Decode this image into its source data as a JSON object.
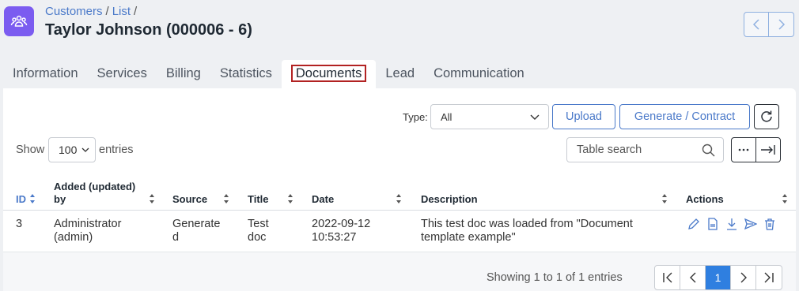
{
  "breadcrumb": {
    "part1": "Customers",
    "sep1": "/",
    "part2": "List",
    "sep2": "/"
  },
  "title": "Taylor Johnson (000006 - 6)",
  "tabs": [
    {
      "label": "Information"
    },
    {
      "label": "Services"
    },
    {
      "label": "Billing"
    },
    {
      "label": "Statistics"
    },
    {
      "label": "Documents"
    },
    {
      "label": "Lead"
    },
    {
      "label": "Communication"
    }
  ],
  "toolbar": {
    "type_label": "Type:",
    "type_value": "All",
    "upload_label": "Upload",
    "generate_label": "Generate / Contract"
  },
  "table_controls": {
    "show_label": "Show",
    "entries_value": "100",
    "entries_label": "entries",
    "search_placeholder": "Table search"
  },
  "columns": {
    "id": "ID",
    "added_line1": "Added (updated)",
    "added_line2": "by",
    "source": "Source",
    "title": "Title",
    "date": "Date",
    "description": "Description",
    "actions": "Actions"
  },
  "rows": [
    {
      "id": "3",
      "added_line1": "Administrator",
      "added_line2": "(admin)",
      "source_line1": "Generate",
      "source_line2": "d",
      "title_line1": "Test",
      "title_line2": "doc",
      "date_line1": "2022-09-12",
      "date_line2": "10:53:27",
      "desc_line1": "This test doc was loaded from \"Document",
      "desc_line2": "template example\""
    }
  ],
  "footer": {
    "showing": "Showing 1 to 1 of 1 entries",
    "current_page": "1"
  },
  "colors": {
    "accent": "#4a79c9",
    "app_icon": "#7b5cf0",
    "active_tab_outline": "#b22222",
    "current_page": "#2f7fe0"
  }
}
